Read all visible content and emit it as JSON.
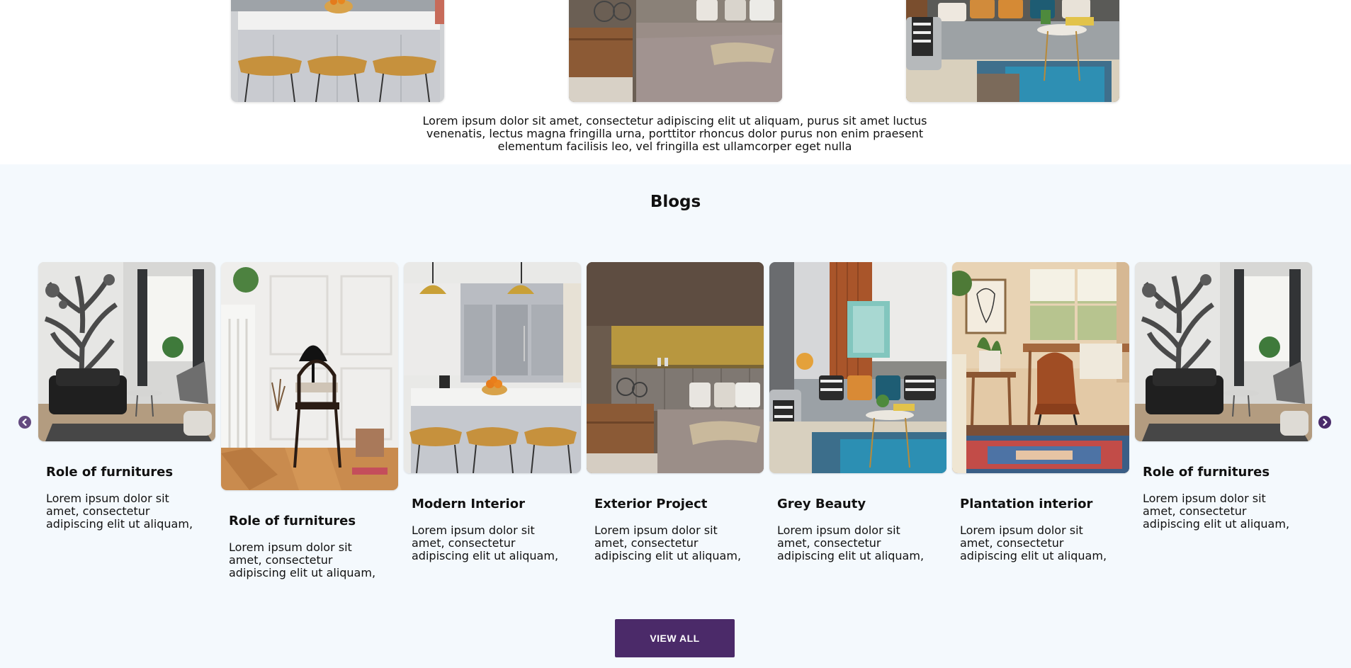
{
  "top_section": {
    "caption": "Lorem ipsum dolor sit amet, consectetur adipiscing elit ut aliquam, purus sit amet luctus venenatis, lectus magna fringilla urna, porttitor rhoncus dolor purus non enim praesent elementum facilisis leo, vel fringilla est ullamcorper eget nulla"
  },
  "blogs": {
    "heading": "Blogs",
    "cards": [
      {
        "title": "Role of furnitures",
        "description": "Lorem ipsum dolor sit amet, consectetur adipiscing elit ut aliquam,"
      },
      {
        "title": "Role of furnitures",
        "description": "Lorem ipsum dolor sit amet, consectetur adipiscing elit ut aliquam,"
      },
      {
        "title": "Modern Interior",
        "description": "Lorem ipsum dolor sit amet, consectetur adipiscing elit ut aliquam,"
      },
      {
        "title": "Exterior Project",
        "description": "Lorem ipsum dolor sit amet, consectetur adipiscing elit ut aliquam,"
      },
      {
        "title": "Grey Beauty",
        "description": "Lorem ipsum dolor sit amet, consectetur adipiscing elit ut aliquam,"
      },
      {
        "title": "Plantation interior",
        "description": "Lorem ipsum dolor sit amet, consectetur adipiscing elit ut aliquam,"
      },
      {
        "title": "Role of furnitures",
        "description": "Lorem ipsum dolor sit amet, consectetur adipiscing elit ut aliquam,"
      }
    ],
    "prev_icon": "chevron-left-icon",
    "next_icon": "chevron-right-icon",
    "view_all_label": "VIEW ALL"
  },
  "colors": {
    "accent": "#4b2a69",
    "section_bg": "#f4f9fd"
  }
}
